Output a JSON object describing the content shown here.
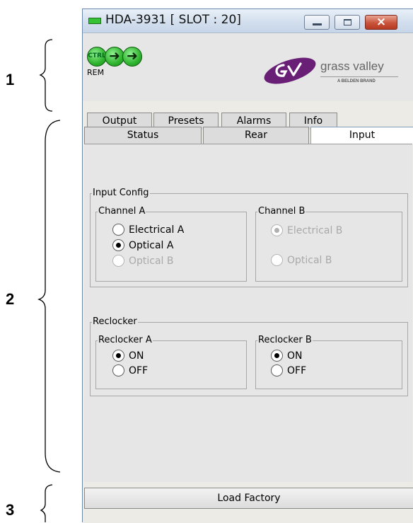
{
  "callouts": [
    "1",
    "2",
    "3"
  ],
  "window": {
    "title": "HDA-3931 [ SLOT : 20]",
    "close_glyph": "×"
  },
  "header": {
    "ctrl_label": "CTRL",
    "rem_label": "REM",
    "arrow_glyph": "➜",
    "brand": {
      "name": "grass valley",
      "tagline": "A BELDEN BRAND",
      "logo_icon": "gv-logo-icon"
    }
  },
  "tabs": {
    "row1": [
      "Output",
      "Presets",
      "Alarms",
      "Info"
    ],
    "row2": [
      "Status",
      "Rear",
      "Input"
    ],
    "active": "Input"
  },
  "input_config": {
    "title": "Input Config",
    "channel_a": {
      "title": "Channel A",
      "options": [
        {
          "label": "Electrical A",
          "selected": false,
          "enabled": true
        },
        {
          "label": "Optical A",
          "selected": true,
          "enabled": true
        },
        {
          "label": "Optical B",
          "selected": false,
          "enabled": false
        }
      ]
    },
    "channel_b": {
      "title": "Channel B",
      "options": [
        {
          "label": "Electrical B",
          "selected": true,
          "enabled": false
        },
        {
          "label": "Optical B",
          "selected": false,
          "enabled": false
        }
      ]
    }
  },
  "reclocker": {
    "title": "Reclocker",
    "reclocker_a": {
      "title": "Reclocker A",
      "options": [
        {
          "label": "ON",
          "selected": true
        },
        {
          "label": "OFF",
          "selected": false
        }
      ]
    },
    "reclocker_b": {
      "title": "Reclocker B",
      "options": [
        {
          "label": "ON",
          "selected": true
        },
        {
          "label": "OFF",
          "selected": false
        }
      ]
    }
  },
  "footer": {
    "load_factory_label": "Load Factory"
  },
  "colors": {
    "led_green": "#2fb32f",
    "close_red": "#c9543c",
    "logo_purple": "#6a1f77"
  }
}
